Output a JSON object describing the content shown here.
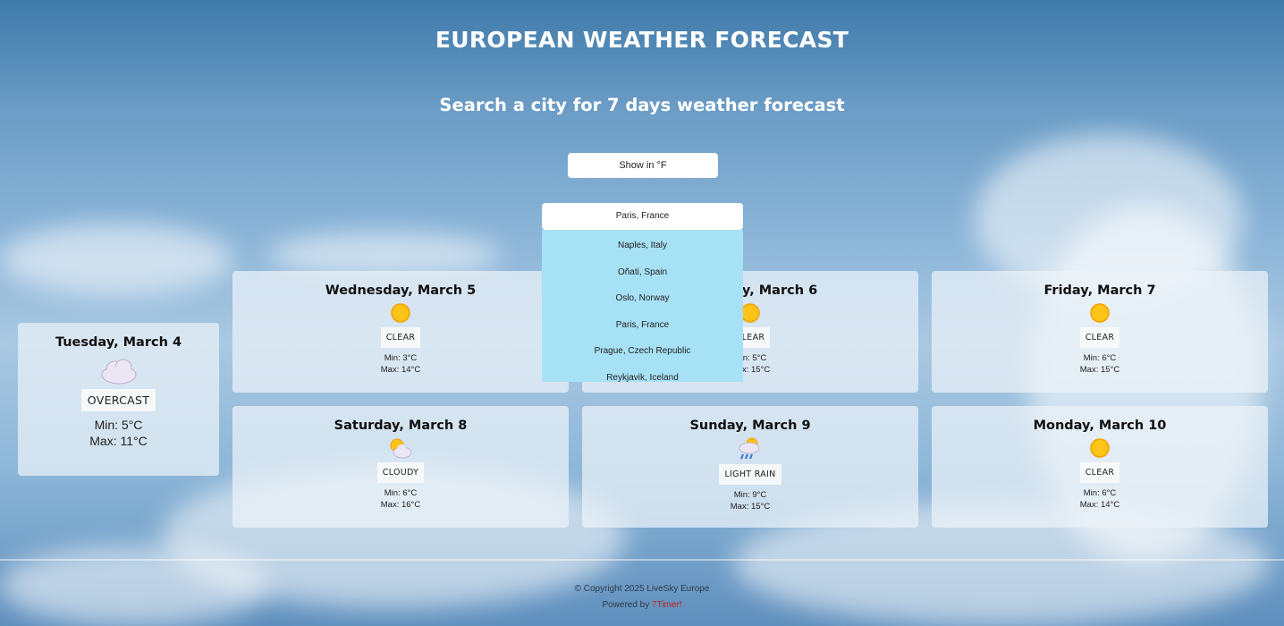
{
  "header": {
    "title": "EUROPEAN WEATHER FORECAST",
    "subtitle": "Search a city for 7 days weather forecast"
  },
  "controls": {
    "unit_toggle_label": "Show in °F",
    "city_selected": "Paris, France",
    "city_options": [
      "Naples, Italy",
      "Oñati, Spain",
      "Oslo, Norway",
      "Paris, France",
      "Prague, Czech Republic",
      "Reykjavik, Iceland"
    ]
  },
  "forecast": [
    {
      "day": "Tuesday, March 4",
      "icon": "cloud-icon",
      "condition": "OVERCAST",
      "min": "Min: 5°C",
      "max": "Max: 11°C"
    },
    {
      "day": "Wednesday, March 5",
      "icon": "sun-icon",
      "condition": "CLEAR",
      "min": "Min: 3°C",
      "max": "Max: 14°C"
    },
    {
      "day": "Thursday, March 6",
      "icon": "sun-icon",
      "condition": "CLEAR",
      "min": "Min: 5°C",
      "max": "Max: 15°C"
    },
    {
      "day": "Friday, March 7",
      "icon": "sun-icon",
      "condition": "CLEAR",
      "min": "Min: 6°C",
      "max": "Max: 15°C"
    },
    {
      "day": "Saturday, March 8",
      "icon": "partly-cloudy-icon",
      "condition": "CLOUDY",
      "min": "Min: 6°C",
      "max": "Max: 16°C"
    },
    {
      "day": "Sunday, March 9",
      "icon": "rain-cloud-icon",
      "condition": "LIGHT RAIN",
      "min": "Min: 9°C",
      "max": "Max: 15°C"
    },
    {
      "day": "Monday, March 10",
      "icon": "sun-icon",
      "condition": "CLEAR",
      "min": "Min: 6°C",
      "max": "Max: 14°C"
    }
  ],
  "footer": {
    "copyright": "© Copyright 2025 LiveSky Europe",
    "powered_prefix": "Powered by",
    "powered_link": "7Timer!"
  },
  "colors": {
    "dropdown_bg": "#a7e1f6",
    "sun": "#fcc419",
    "link": "#c0221c"
  }
}
